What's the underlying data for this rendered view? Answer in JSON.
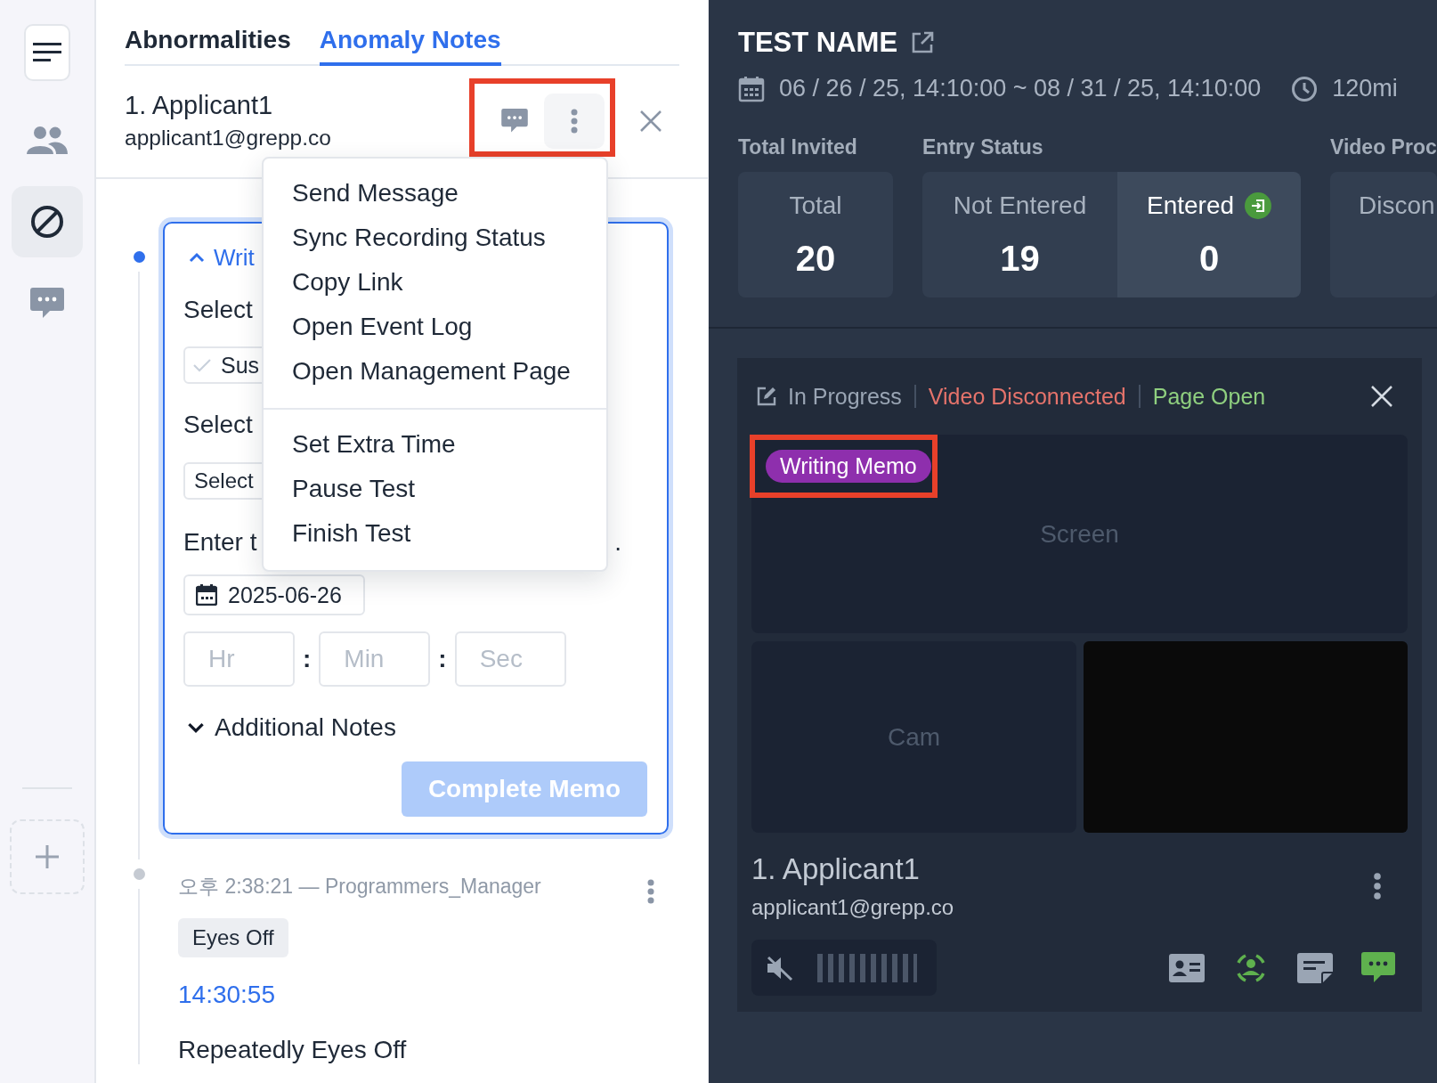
{
  "sidebar": {
    "items": [
      {
        "kind": "menu",
        "selected": false
      },
      {
        "kind": "people",
        "selected": false
      },
      {
        "kind": "block",
        "selected": true
      },
      {
        "kind": "chat",
        "selected": false
      }
    ]
  },
  "tabs": [
    {
      "label": "Abnormalities",
      "selected": false
    },
    {
      "label": "Anomaly Notes",
      "selected": true
    }
  ],
  "applicant": {
    "name": "1. Applicant1",
    "email": "applicant1@grepp.co"
  },
  "menu": {
    "groups": [
      [
        "Send Message",
        "Sync Recording Status",
        "Copy Link",
        "Open Event Log",
        "Open Management Page"
      ],
      [
        "Set Extra Time",
        "Pause Test",
        "Finish Test"
      ]
    ]
  },
  "memo": {
    "header": "Writ",
    "expanded": true,
    "label_1": "Select",
    "checkbox_text": "Sus",
    "checked": true,
    "label_2": "Select",
    "select_text": "Select",
    "label_3": "Enter t",
    "label_3_end": ".",
    "date": "2025-06-26",
    "time_placeholders": [
      "Hr",
      "Min",
      "Sec"
    ],
    "time_separator": ":",
    "notes_label": "Additional Notes",
    "notes_expanded": false,
    "button": "Complete Memo",
    "button_disabled": true
  },
  "log": {
    "meta": "오후 2:38:21 — Programmers_Manager",
    "tag": "Eyes Off",
    "time": "14:30:55",
    "note": "Repeatedly Eyes Off"
  },
  "test": {
    "title": "TEST NAME",
    "period": "06 / 26 / 25, 14:10:00 ~ 08 / 31 / 25, 14:10:00",
    "duration": "120mi"
  },
  "stats": [
    {
      "heading": "Total Invited",
      "cells": [
        {
          "kind": "count",
          "label": "Total",
          "value": "20",
          "selected": false
        }
      ]
    },
    {
      "heading": "Entry Status",
      "cells": [
        {
          "kind": "count",
          "label": "Not Entered",
          "value": "19",
          "selected": false
        },
        {
          "kind": "entered",
          "label": "Entered",
          "value": "0",
          "selected": true
        }
      ]
    },
    {
      "heading": "Video Proc",
      "cells": [
        {
          "kind": "count",
          "label": "Discon",
          "selected": false
        }
      ]
    }
  ],
  "monitor": {
    "statuses": [
      {
        "label": "In Progress",
        "color": "#9aa5b4"
      },
      {
        "label": "Video Disconnected",
        "color": "#e5736b"
      },
      {
        "label": "Page Open",
        "color": "#8fcf7f"
      }
    ],
    "badge": "Writing Memo",
    "screen_label": "Screen",
    "cam_label": "Cam",
    "name": "1. Applicant1",
    "email": "applicant1@grepp.co",
    "muted": true
  }
}
